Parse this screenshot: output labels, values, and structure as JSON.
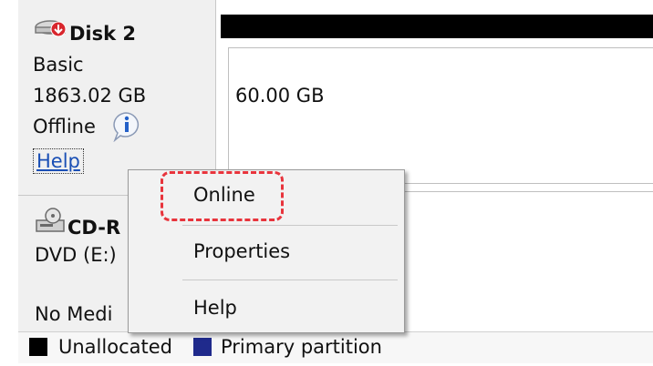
{
  "disk2": {
    "name": "Disk 2",
    "type": "Basic",
    "size": "1863.02 GB",
    "status": "Offline",
    "help_link": "Help",
    "volume_size": "60.00 GB"
  },
  "cdrom": {
    "name": "CD-R",
    "drive": "DVD (E:)",
    "status": "No Medi"
  },
  "context_menu": {
    "items": [
      "Online",
      "Properties",
      "Help"
    ],
    "highlight_color": "#e8343c"
  },
  "legend": {
    "unallocated": "Unallocated",
    "primary": "Primary partition",
    "unallocated_color": "#000000",
    "primary_color": "#1f2a8c"
  }
}
